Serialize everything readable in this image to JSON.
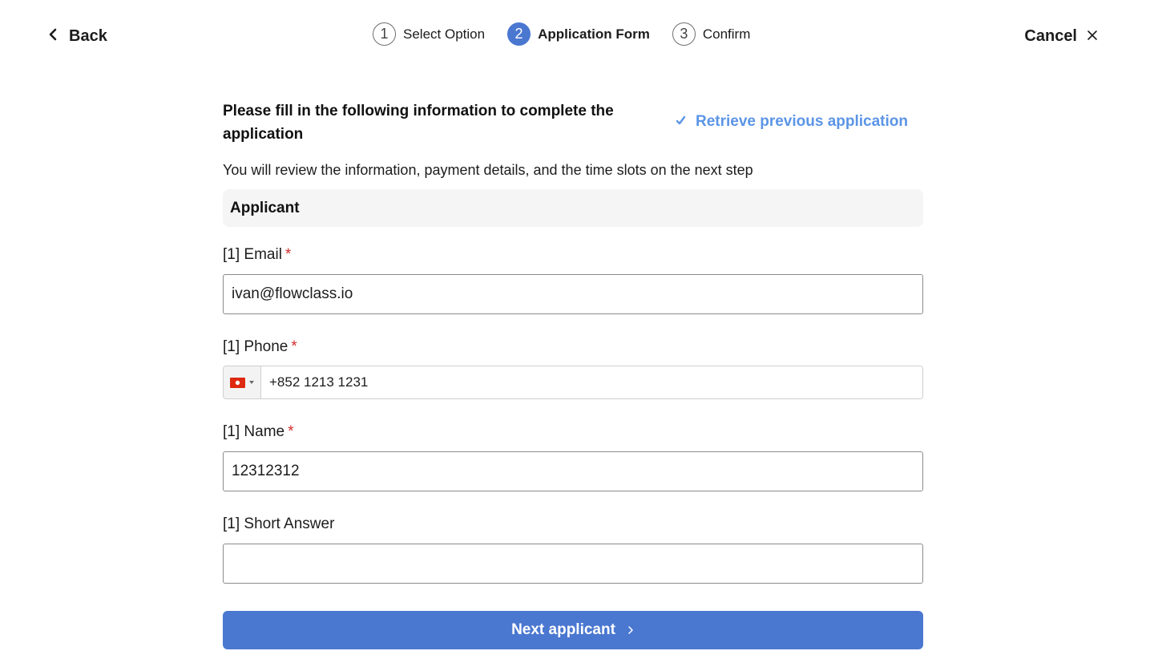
{
  "header": {
    "back_label": "Back",
    "cancel_label": "Cancel",
    "steps": [
      {
        "number": "1",
        "label": "Select Option",
        "active": false
      },
      {
        "number": "2",
        "label": "Application Form",
        "active": true
      },
      {
        "number": "3",
        "label": "Confirm",
        "active": false
      }
    ]
  },
  "form": {
    "title": "Please fill in the following information to complete the application",
    "retrieve_label": "Retrieve previous application",
    "subtitle": "You will review the information, payment details, and the time slots on the next step",
    "section_title": "Applicant",
    "required_marker": "*",
    "fields": {
      "email": {
        "label": "[1] Email",
        "value": "ivan@flowclass.io",
        "required": true
      },
      "phone": {
        "label": "[1] Phone",
        "value": "+852 1213 1231",
        "country_icon": "hong-kong-flag-icon",
        "required": true
      },
      "name": {
        "label": "[1] Name",
        "value": "12312312",
        "required": true
      },
      "short_answer": {
        "label": "[1] Short Answer",
        "value": "",
        "required": false
      }
    },
    "next_label": "Next applicant"
  },
  "colors": {
    "primary": "#4a77d0",
    "link": "#5b95e6",
    "required": "#d42b2b",
    "section_bg": "#f5f5f5"
  }
}
